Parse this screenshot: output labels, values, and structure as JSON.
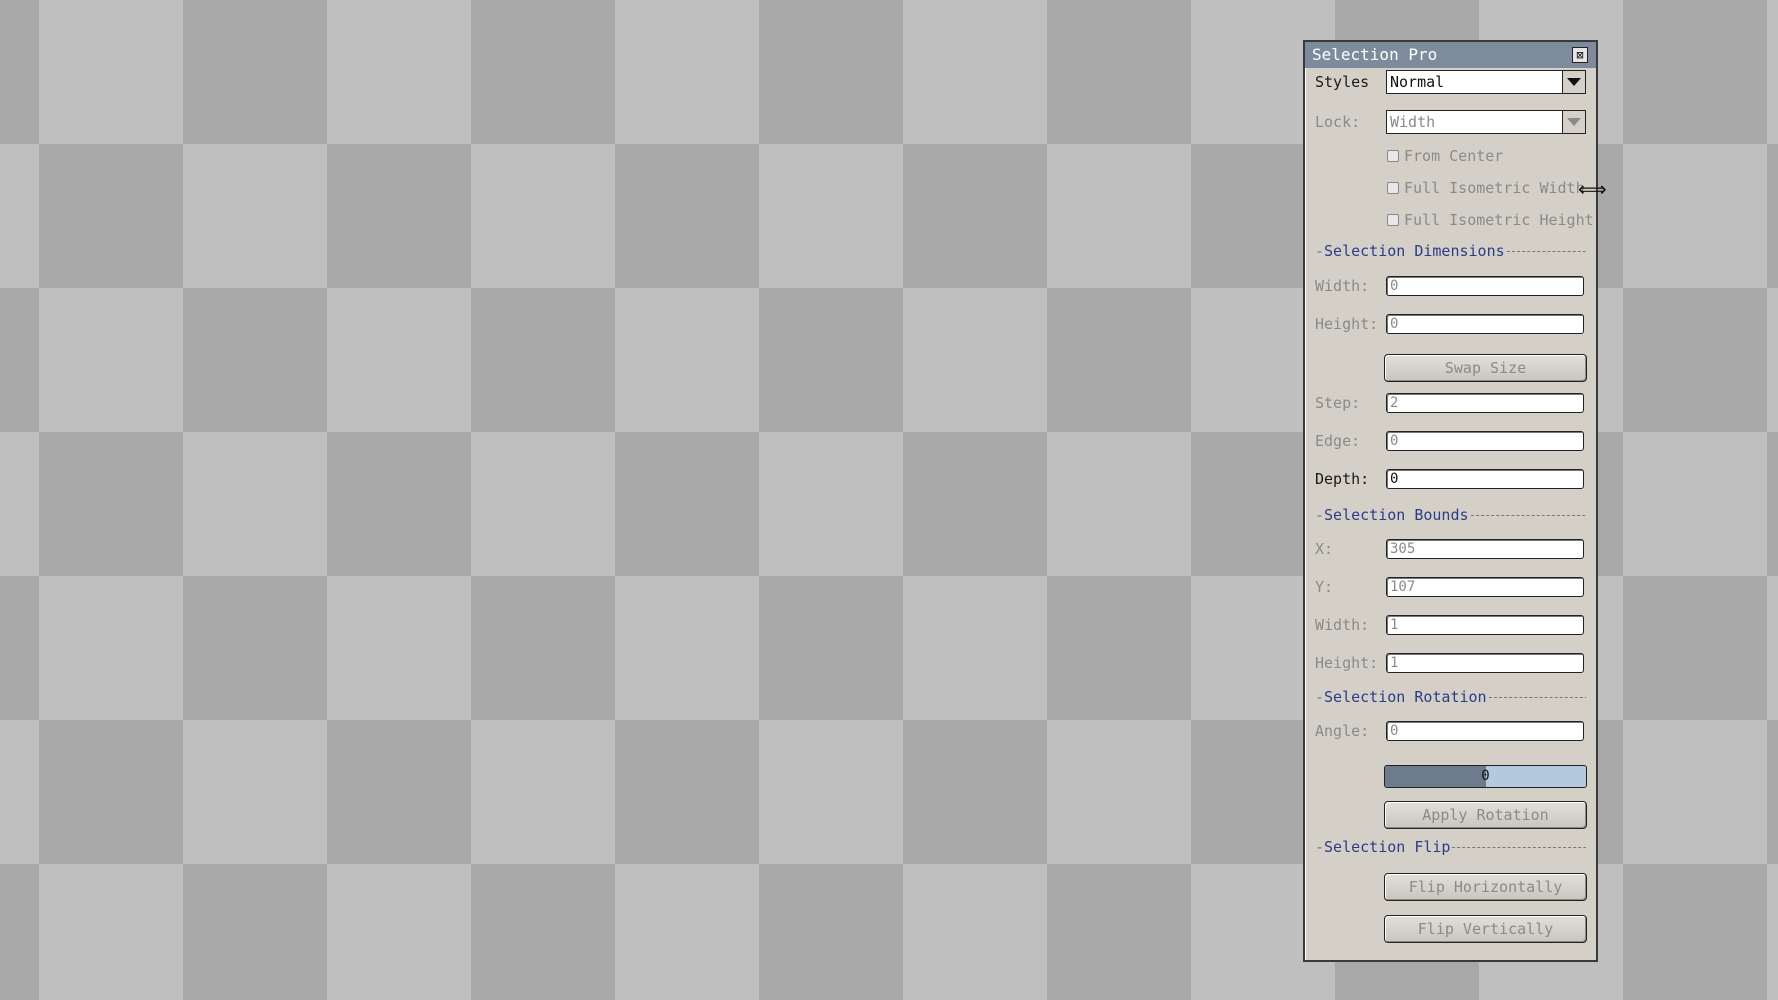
{
  "panel": {
    "title": "Selection Pro",
    "close_glyph": "⊠",
    "styles": {
      "label": "Styles",
      "value": "Normal"
    },
    "lock": {
      "label": "Lock:",
      "value": "Width"
    },
    "checkboxes": [
      {
        "label": "From Center",
        "checked": false
      },
      {
        "label": "Full Isometric Width",
        "checked": false
      },
      {
        "label": "Full Isometric Height",
        "checked": false
      }
    ],
    "dimensions": {
      "heading": "Selection Dimensions",
      "width_label": "Width:",
      "width_value": "0",
      "height_label": "Height:",
      "height_value": "0",
      "swap_button": "Swap Size",
      "step_label": "Step:",
      "step_value": "2",
      "edge_label": "Edge:",
      "edge_value": "0",
      "depth_label": "Depth:",
      "depth_value": "0"
    },
    "bounds": {
      "heading": "Selection Bounds",
      "x_label": "X:",
      "x_value": "305",
      "y_label": "Y:",
      "y_value": "107",
      "width_label": "Width:",
      "width_value": "1",
      "height_label": "Height:",
      "height_value": "1"
    },
    "rotation": {
      "heading": "Selection Rotation",
      "angle_label": "Angle:",
      "angle_value": "0",
      "slider_value": "0",
      "slider_fraction": 0.5,
      "apply_button": "Apply Rotation"
    },
    "flip": {
      "heading": "Selection Flip",
      "horizontal_button": "Flip Horizontally",
      "vertical_button": "Flip Vertically"
    }
  },
  "cursor": {
    "icon": "resize-horizontal-icon",
    "glyph": "⟺"
  },
  "colors": {
    "titlebar": "#7d8b9c",
    "panel_bg": "#d4d0c8",
    "section_heading": "#2b3d8a",
    "checker_light": "#bfbfbf",
    "checker_dark": "#a9a9a9"
  }
}
